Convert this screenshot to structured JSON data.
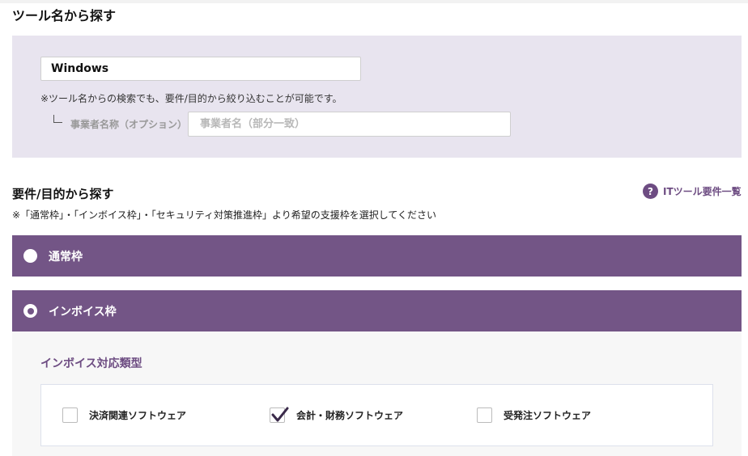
{
  "tool_search": {
    "heading": "ツール名から探す",
    "tool_name_value": "Windows",
    "note": "※ツール名からの検索でも、要件/目的から絞り込むことが可能です。",
    "business_label": "事業者名称（オプション）",
    "business_placeholder": "事業者名（部分一致）"
  },
  "requirement_search": {
    "heading": "要件/目的から探す",
    "help_link": "ITツール要件一覧",
    "help_icon": "?",
    "note": "※「通常枠」・「インボイス枠」・「セキュリティ対策推進枠」より希望の支援枠を選択してください"
  },
  "frames": [
    {
      "label": "通常枠",
      "selected": false
    },
    {
      "label": "インボイス枠",
      "selected": true
    }
  ],
  "invoice": {
    "type_title": "インボイス対応類型",
    "options": [
      {
        "label": "決済関連ソフトウェア",
        "checked": false
      },
      {
        "label": "会計・財務ソフトウェア",
        "checked": true
      },
      {
        "label": "受発注ソフトウェア",
        "checked": false
      }
    ]
  },
  "colors": {
    "accent": "#735586",
    "panel": "#e8e4ef"
  }
}
